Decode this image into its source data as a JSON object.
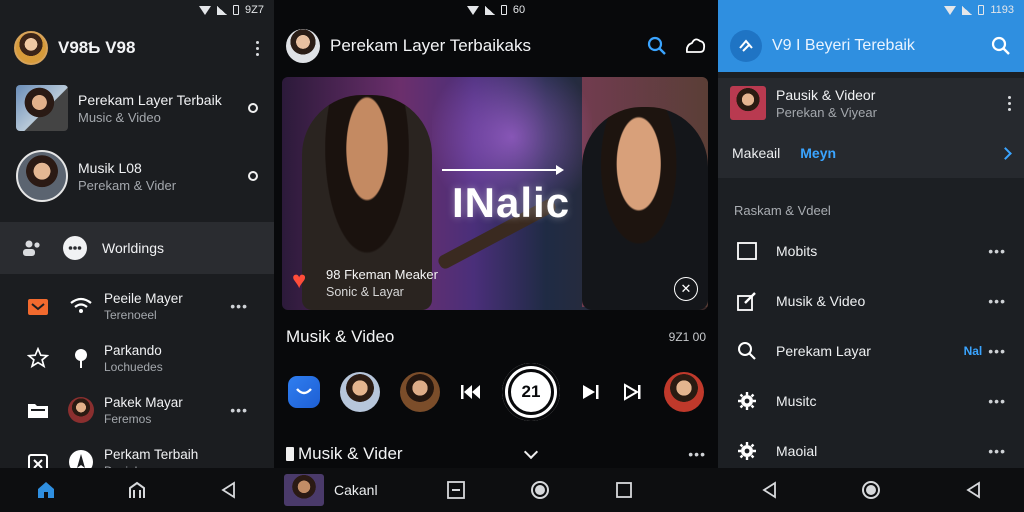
{
  "panel1": {
    "status": {
      "time": "9Z7"
    },
    "header": {
      "title": "V98Ƅ V98"
    },
    "media_items": [
      {
        "title": "Perekam Layer Terbaik",
        "subtitle": "Music & Video"
      },
      {
        "title": "Musik L08",
        "subtitle": "Perekam & Vider"
      }
    ],
    "highlight_label": "Worldings",
    "menu": [
      {
        "title": "Peeile Mayer",
        "subtitle": "Terenoeel"
      },
      {
        "title": "Parkando",
        "subtitle": "Lochuedes"
      },
      {
        "title": "Pakek Mayar",
        "subtitle": "Feremos"
      },
      {
        "title": "Perkam Terbaih",
        "subtitle": "Desighus"
      }
    ],
    "more_glyph": "•••"
  },
  "panel2": {
    "status": {
      "time": "60"
    },
    "header": {
      "title": "Perekam Layer Terbaikaks"
    },
    "hero": {
      "word": "INalic",
      "caption_title": "98 Fkeman Meaker",
      "caption_sub": "Sonic & Layar"
    },
    "section": {
      "title": "Musik & Video",
      "time": "9Z1 00"
    },
    "player": {
      "big_label": "21"
    },
    "row2": {
      "title": "Musik & Vider"
    },
    "more_glyph": "•••",
    "mini": {
      "label": "Cakanl"
    }
  },
  "panel3": {
    "status": {
      "time": "1193"
    },
    "header": {
      "title": "V9 I Beyeri Terebaik"
    },
    "card": {
      "title": "Pausik & Videor",
      "subtitle": "Perekan & Viyear"
    },
    "link": {
      "label": "Makeail",
      "value": "Meyn"
    },
    "section_label": "Raskam & Vdeel",
    "rows": [
      {
        "label": "Mobits",
        "badge": ""
      },
      {
        "label": "Musik & Video",
        "badge": ""
      },
      {
        "label": "Perekam Layar",
        "badge": "Nal"
      },
      {
        "label": "Musitc",
        "badge": ""
      },
      {
        "label": "Maoial",
        "badge": ""
      }
    ],
    "more_glyph": "•••"
  },
  "colors": {
    "accent_blue": "#2f8fe0",
    "link_blue": "#3aa4ff",
    "heart": "#ff4d3a",
    "panel_bg": "#1b1d20"
  },
  "icons": [
    "wifi-icon",
    "signal-icon",
    "battery-icon",
    "search-icon",
    "cast-icon",
    "kebab-icon",
    "home-icon",
    "back-icon",
    "skip-back-icon",
    "skip-forward-icon"
  ]
}
